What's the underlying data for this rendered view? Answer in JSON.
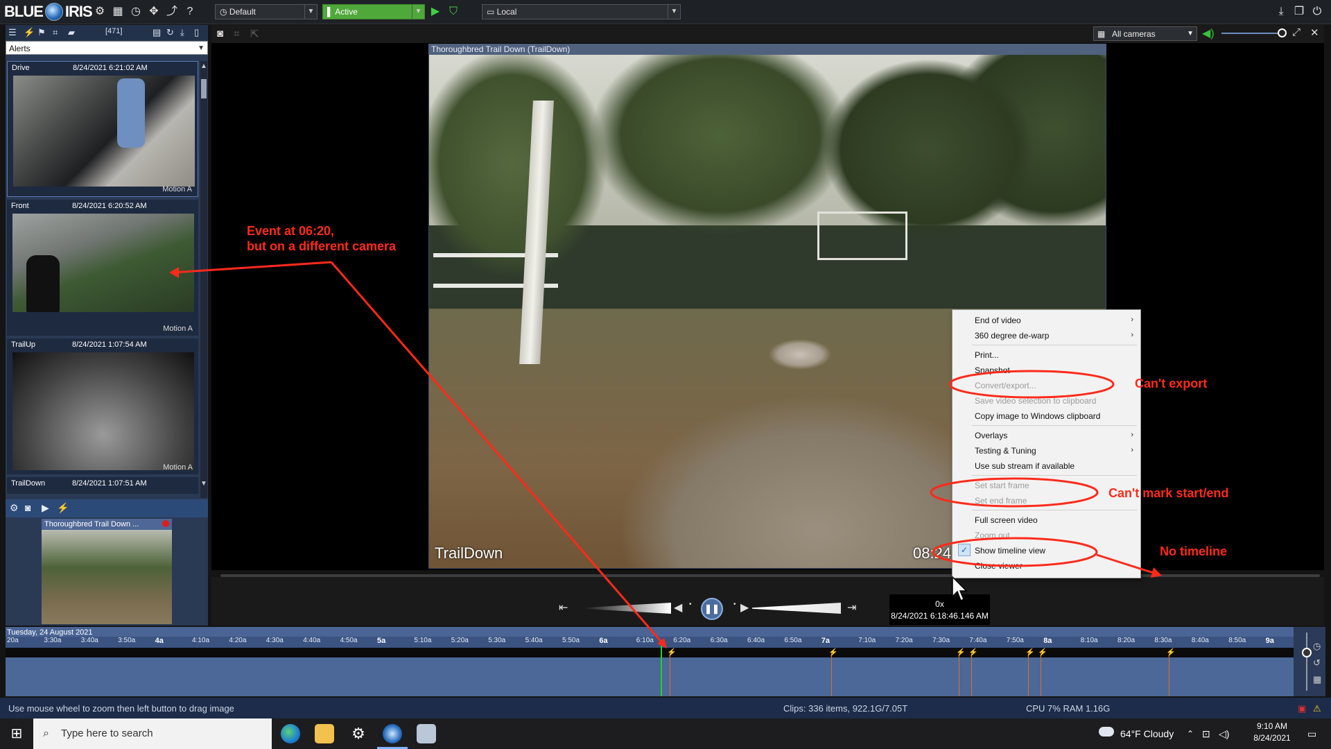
{
  "app": {
    "logo_text_1": "BLUE",
    "logo_text_2": "IRIS"
  },
  "toolbar": {
    "profile": "Default",
    "schedule": "Active",
    "server": "Local"
  },
  "left_panel": {
    "count": "[471]",
    "filter": "Alerts",
    "clips": [
      {
        "camera": "Drive",
        "timestamp": "8/24/2021 6:21:02 AM",
        "trigger": "Motion A"
      },
      {
        "camera": "Front",
        "timestamp": "8/24/2021 6:20:52 AM",
        "trigger": "Motion A"
      },
      {
        "camera": "TrailUp",
        "timestamp": "8/24/2021 1:07:54 AM",
        "trigger": "Motion A"
      },
      {
        "camera": "TrailDown",
        "timestamp": "8/24/2021 1:07:51 AM",
        "trigger": ""
      }
    ],
    "mini_camera_title": "Thoroughbred Trail Down ..."
  },
  "view": {
    "camera_filter": "All cameras",
    "title": "Thoroughbred Trail Down (TrailDown)",
    "overlay_name": "TrailDown",
    "overlay_time": "08:24"
  },
  "playback": {
    "speed": "0x",
    "timestamp": "8/24/2021 6:18:46.146 AM"
  },
  "timeline": {
    "date": "Tuesday, 24 August 2021",
    "ticks": [
      "20a",
      "3:30a",
      "3:40a",
      "3:50a",
      "4a",
      "4:10a",
      "4:20a",
      "4:30a",
      "4:40a",
      "4:50a",
      "5a",
      "5:10a",
      "5:20a",
      "5:30a",
      "5:40a",
      "5:50a",
      "6a",
      "6:10a",
      "6:20a",
      "6:30a",
      "6:40a",
      "6:50a",
      "7a",
      "7:10a",
      "7:20a",
      "7:30a",
      "7:40a",
      "7:50a",
      "8a",
      "8:10a",
      "8:20a",
      "8:30a",
      "8:40a",
      "8:50a",
      "9a"
    ]
  },
  "context_menu": {
    "items": [
      {
        "label": "End of video",
        "disabled": false,
        "submenu": true
      },
      {
        "label": "360 degree de-warp",
        "disabled": false,
        "submenu": true
      },
      {
        "label": "Print...",
        "disabled": false
      },
      {
        "label": "Snapshot",
        "disabled": false
      },
      {
        "label": "Convert/export...",
        "disabled": true
      },
      {
        "label": "Save video selection to clipboard",
        "disabled": true
      },
      {
        "label": "Copy image to Windows clipboard",
        "disabled": false
      },
      {
        "label": "Overlays",
        "disabled": false,
        "submenu": true
      },
      {
        "label": "Testing & Tuning",
        "disabled": false,
        "submenu": true
      },
      {
        "label": "Use sub stream if available",
        "disabled": false
      },
      {
        "label": "Set start frame",
        "disabled": true
      },
      {
        "label": "Set end frame",
        "disabled": true
      },
      {
        "label": "Full screen video",
        "disabled": false
      },
      {
        "label": "Zoom out",
        "disabled": true
      },
      {
        "label": "Show timeline view",
        "disabled": false,
        "checked": true
      },
      {
        "label": "Close viewer",
        "disabled": false
      }
    ]
  },
  "annotations": {
    "event_line1": "Event at 06:20,",
    "event_line2": "but on a different camera",
    "cant_export": "Can't export",
    "cant_mark": "Can't mark start/end",
    "no_timeline": "No timeline"
  },
  "status": {
    "hint": "Use mouse wheel to zoom then left button to drag image",
    "clips": "Clips: 336 items, 922.1G/7.05T",
    "cpu": "CPU 7% RAM 1.16G"
  },
  "taskbar": {
    "search_placeholder": "Type here to search",
    "weather": "64°F  Cloudy",
    "time": "9:10 AM",
    "date": "8/24/2021"
  },
  "colors": {
    "accent": "#4a6595",
    "active_green": "#4fa83a",
    "annotation_red": "#ff2a1a"
  }
}
